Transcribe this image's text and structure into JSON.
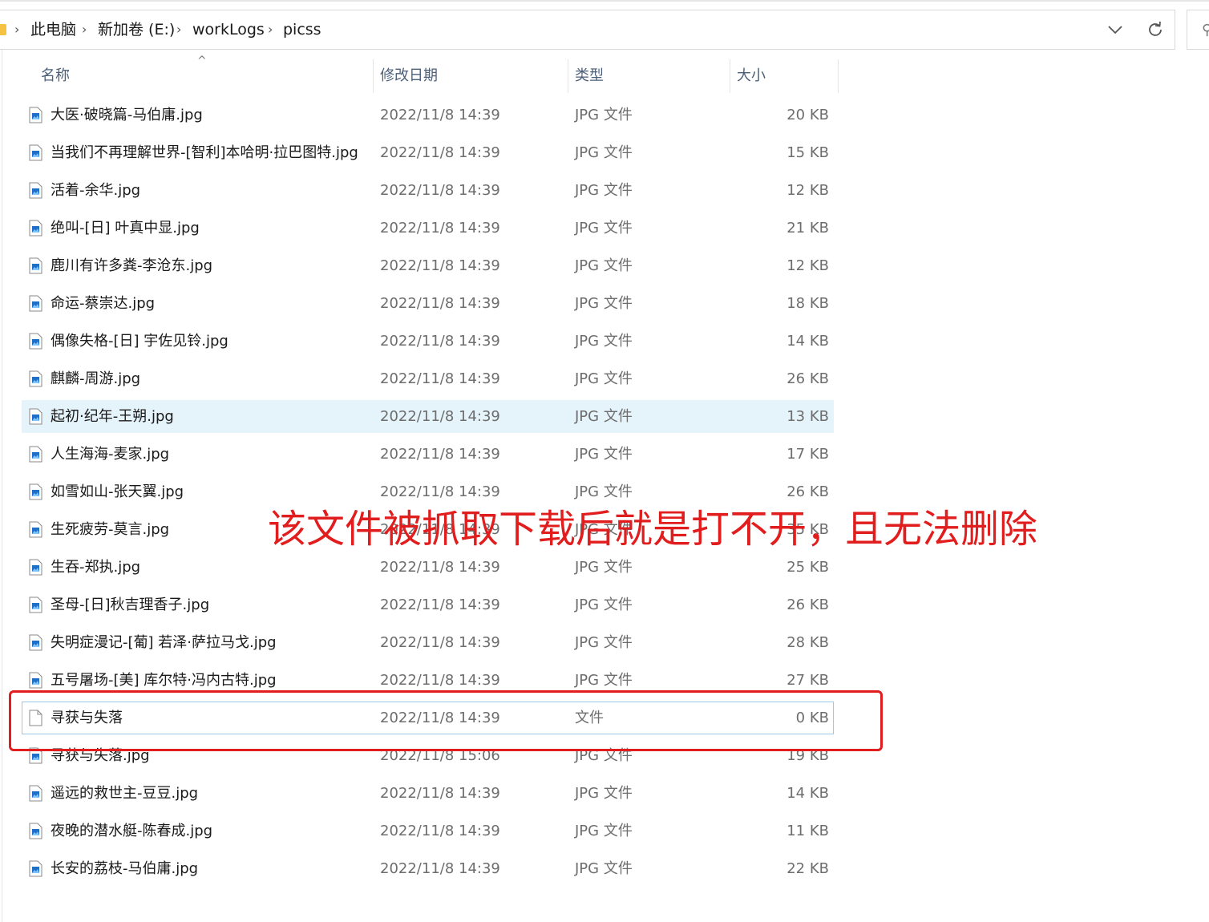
{
  "address": {
    "crumbs": [
      "此电脑",
      "新加卷 (E:)",
      "workLogs",
      "picss"
    ],
    "separator": "›",
    "dropdown_icon": "chevron-down-icon",
    "refresh_icon": "refresh-icon",
    "search_icon": "search-icon"
  },
  "columns": {
    "name": "名称",
    "date": "修改日期",
    "type": "类型",
    "size": "大小"
  },
  "files": [
    {
      "name": "大医·破晓篇-马伯庸.jpg",
      "date": "2022/11/8 14:39",
      "type": "JPG 文件",
      "size": "20 KB"
    },
    {
      "name": "当我们不再理解世界-[智利]本哈明·拉巴图特.jpg",
      "date": "2022/11/8 14:39",
      "type": "JPG 文件",
      "size": "15 KB"
    },
    {
      "name": "活着-余华.jpg",
      "date": "2022/11/8 14:39",
      "type": "JPG 文件",
      "size": "12 KB"
    },
    {
      "name": "绝叫-[日] 叶真中显.jpg",
      "date": "2022/11/8 14:39",
      "type": "JPG 文件",
      "size": "21 KB"
    },
    {
      "name": "鹿川有许多粪-李沧东.jpg",
      "date": "2022/11/8 14:39",
      "type": "JPG 文件",
      "size": "12 KB"
    },
    {
      "name": "命运-蔡崇达.jpg",
      "date": "2022/11/8 14:39",
      "type": "JPG 文件",
      "size": "18 KB"
    },
    {
      "name": "偶像失格-[日] 宇佐见铃.jpg",
      "date": "2022/11/8 14:39",
      "type": "JPG 文件",
      "size": "14 KB"
    },
    {
      "name": "麒麟-周游.jpg",
      "date": "2022/11/8 14:39",
      "type": "JPG 文件",
      "size": "26 KB"
    },
    {
      "name": "起初·纪年-王朔.jpg",
      "date": "2022/11/8 14:39",
      "type": "JPG 文件",
      "size": "13 KB"
    },
    {
      "name": "人生海海-麦家.jpg",
      "date": "2022/11/8 14:39",
      "type": "JPG 文件",
      "size": "17 KB"
    },
    {
      "name": "如雪如山-张天翼.jpg",
      "date": "2022/11/8 14:39",
      "type": "JPG 文件",
      "size": "26 KB"
    },
    {
      "name": "生死疲劳-莫言.jpg",
      "date": "2022/11/8 14:39",
      "type": "JPG 文件",
      "size": "35 KB"
    },
    {
      "name": "生吞-郑执.jpg",
      "date": "2022/11/8 14:39",
      "type": "JPG 文件",
      "size": "25 KB"
    },
    {
      "name": "圣母-[日]秋吉理香子.jpg",
      "date": "2022/11/8 14:39",
      "type": "JPG 文件",
      "size": "26 KB"
    },
    {
      "name": "失明症漫记-[葡] 若泽·萨拉马戈.jpg",
      "date": "2022/11/8 14:39",
      "type": "JPG 文件",
      "size": "28 KB"
    },
    {
      "name": "五号屠场-[美] 库尔特·冯内古特.jpg",
      "date": "2022/11/8 14:39",
      "type": "JPG 文件",
      "size": "27 KB"
    },
    {
      "name": "寻获与失落",
      "date": "2022/11/8 14:39",
      "type": "文件",
      "size": "0 KB"
    },
    {
      "name": "寻获与失落.jpg",
      "date": "2022/11/8 15:06",
      "type": "JPG 文件",
      "size": "19 KB"
    },
    {
      "name": "遥远的救世主-豆豆.jpg",
      "date": "2022/11/8 14:39",
      "type": "JPG 文件",
      "size": "14 KB"
    },
    {
      "name": "夜晚的潜水艇-陈春成.jpg",
      "date": "2022/11/8 14:39",
      "type": "JPG 文件",
      "size": "11 KB"
    },
    {
      "name": "长安的荔枝-马伯庸.jpg",
      "date": "2022/11/8 14:39",
      "type": "JPG 文件",
      "size": "22 KB"
    }
  ],
  "hover_row": 8,
  "focus_row": 16,
  "annotation": {
    "text": "该文件被抓取下载后就是打不开，且无法删除",
    "color": "#e11d1d"
  }
}
